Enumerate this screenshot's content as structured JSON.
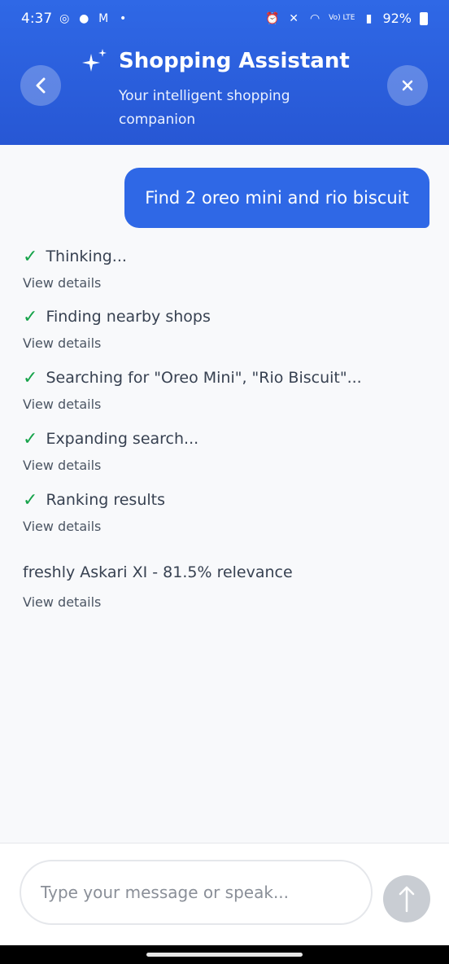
{
  "status_bar": {
    "time": "4:37",
    "battery": "92%",
    "network": "Vo) LTE"
  },
  "header": {
    "title": "Shopping Assistant",
    "subtitle": "Your intelligent shopping companion",
    "back_icon": "chevron-left-icon",
    "close_icon": "close-icon",
    "accent_color": "#2f68e6"
  },
  "chat": {
    "user_message": "Find 2 oreo mini and rio biscuit",
    "steps": [
      {
        "label": "Thinking...",
        "details": "View details"
      },
      {
        "label": "Finding nearby shops",
        "details": "View details"
      },
      {
        "label": "Searching for \"Oreo Mini\", \"Rio Biscuit\"...",
        "details": "View details"
      },
      {
        "label": "Expanding search...",
        "details": "View details"
      },
      {
        "label": "Ranking results",
        "details": "View details"
      }
    ],
    "result": {
      "text": "freshly Askari XI - 81.5% relevance",
      "details": "View details"
    }
  },
  "composer": {
    "placeholder": "Type your message or speak...",
    "send_icon": "arrow-up-icon"
  }
}
